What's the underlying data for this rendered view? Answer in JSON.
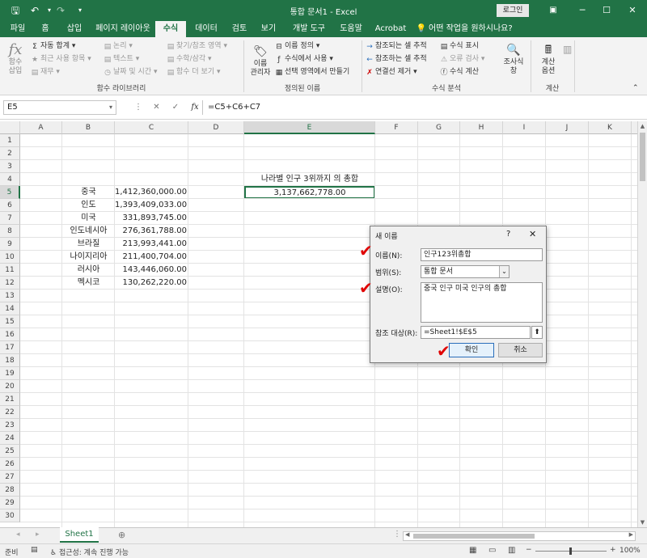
{
  "window": {
    "title": "통합 문서1  -  Excel",
    "login": "로그인"
  },
  "tabs": [
    "파일",
    "홈",
    "삽입",
    "페이지 레이아웃",
    "수식",
    "데이터",
    "검토",
    "보기",
    "개발 도구",
    "도움말",
    "Acrobat"
  ],
  "tell_me": "어떤 작업을 원하시나요?",
  "ribbon": {
    "insert_function": "함수\n삽입",
    "autosum": "자동 합계",
    "recent": "최근 사용 항목",
    "financial": "재무",
    "logical": "논리",
    "text": "텍스트",
    "datetime": "날짜 및 시간",
    "lookup": "찾기/참조 영역",
    "math": "수학/삼각",
    "more": "함수 더 보기",
    "group_library": "함수 라이브러리",
    "name_manager": "이름\n관리자",
    "define_name": "이름 정의",
    "use_in_formula": "수식에서 사용",
    "create_from_sel": "선택 영역에서 만들기",
    "group_names": "정의된 이름",
    "trace_precedents": "참조되는 셀 추적",
    "trace_dependents": "참조하는 셀 추적",
    "remove_arrows": "연결선 제거",
    "show_formulas": "수식 표시",
    "error_checking": "오류 검사",
    "evaluate": "수식 계산",
    "watch_window": "조사식\n창",
    "group_audit": "수식 분석",
    "calc_options": "계산\n옵션",
    "group_calc": "계산"
  },
  "formula_bar": {
    "cell_ref": "E5",
    "formula": "=C5+C6+C7"
  },
  "columns": [
    "A",
    "B",
    "C",
    "D",
    "E",
    "F",
    "G",
    "H",
    "I",
    "J",
    "K"
  ],
  "rows": [
    "1",
    "2",
    "3",
    "4",
    "5",
    "6",
    "7",
    "8",
    "9",
    "10",
    "11",
    "12",
    "13",
    "14",
    "15",
    "16",
    "17",
    "18",
    "19",
    "20",
    "21",
    "22",
    "23",
    "24",
    "25",
    "26",
    "27",
    "28",
    "29",
    "30"
  ],
  "sheet": {
    "e4_heading": "나라별 인구 3위까지 의 총합",
    "e5_value": "3,137,662,778.00",
    "countries": [
      {
        "name": "중국",
        "pop": "1,412,360,000.00"
      },
      {
        "name": "인도",
        "pop": "1,393,409,033.00"
      },
      {
        "name": "미국",
        "pop": "331,893,745.00"
      },
      {
        "name": "인도네시아",
        "pop": "276,361,788.00"
      },
      {
        "name": "브라질",
        "pop": "213,993,441.00"
      },
      {
        "name": "나이지리아",
        "pop": "211,400,704.00"
      },
      {
        "name": "러시아",
        "pop": "143,446,060.00"
      },
      {
        "name": "멕시코",
        "pop": "130,262,220.00"
      }
    ]
  },
  "dialog": {
    "title": "새 이름",
    "help": "?",
    "close": "✕",
    "name_label": "이름(N):",
    "name_value": "인구123위총합",
    "scope_label": "범위(S):",
    "scope_value": "통합 문서",
    "comment_label": "설명(O):",
    "comment_value": "중국 인구 미국 인구의 총합",
    "refers_label": "참조 대상(R):",
    "refers_value": "=Sheet1!$E$5",
    "ok": "확인",
    "cancel": "취소"
  },
  "sheet_tab": "Sheet1",
  "status": {
    "ready": "준비",
    "accessibility": "접근성: 계속 진행 가능",
    "zoom": "100%"
  },
  "colors": {
    "excel_green": "#217346",
    "annotation_red": "#e00000"
  }
}
